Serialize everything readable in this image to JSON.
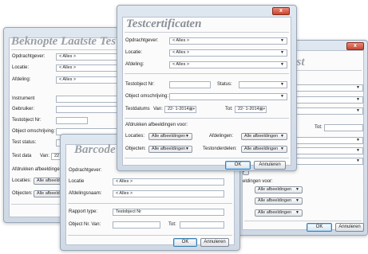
{
  "back_left": {
    "title": "Beknopte Laatste Tes",
    "opdrachtgever_label": "Opdrachtgever:",
    "opdrachtgever_value": "< Alles >",
    "locatie_label": "Locatie:",
    "locatie_value": "< Alles >",
    "afdeling_label": "Afdeling:",
    "afdeling_value": "< Alles >",
    "instrument_label": "Instrument",
    "gebruiker_label": "Gebruiker:",
    "testobject_label": "Testobject Nr:",
    "omschrijving_label": "Object omschrijving:",
    "teststatus_label": "Test status:",
    "testdata_label": "Test data",
    "van_label": "Van:",
    "van_value": "22",
    "afdrukken_label": "Afdrukken afbeeldingen",
    "locaties_label": "Locaties:",
    "locaties_value": "Alle afbeeldi",
    "objecten_label": "Objecten:",
    "objecten_value": "Alle afbeeldi"
  },
  "back_right": {
    "title": "enlijst",
    "tot_label": "Tot:",
    "afdrukken_label": "eldingen voor:",
    "opt1": "Alle afbeeldingen",
    "opt2": "Alle afbeeldingen",
    "opt3": "Alle afbeeldingen",
    "ok_label": "OK",
    "cancel_label": "Annuleren"
  },
  "barcode": {
    "title": "Barcode li",
    "opdrachtgever_label": "Opdrachtgever:",
    "locatie_label": "Locatie",
    "locatie_value": "< Alles >",
    "afdelingsnaam_label": "Afdelingsnaam:",
    "afdelingsnaam_value": "< Alles >",
    "rapport_label": "Rapport type:",
    "rapport_value": "Testobject Nr",
    "objectnr_label": "Object Nr. Van:",
    "tot_label": "Tot:",
    "ok_label": "OK",
    "cancel_label": "Annuleren"
  },
  "front": {
    "title": "Testcertificaten",
    "close_glyph": "x",
    "opdrachtgever_label": "Opdrachtgever:",
    "opdrachtgever_value": "< Alles >",
    "locatie_label": "Locatie:",
    "locatie_value": "< Alles >",
    "afdeling_label": "Afdeling:",
    "afdeling_value": "< Alles >",
    "testobject_label": "Testobject Nr:",
    "status_label": "Status:",
    "omschrijving_label": "Object omschrijving:",
    "testdatums_label": "Testdatums",
    "van_label": "Van:",
    "van_value": "22- 1-2014",
    "tot_label": "Tot:",
    "tot_value": "22- 1-2014",
    "afdrukken_label": "Afdrukken afbeeldingen voor:",
    "locaties_label": "Locaties:",
    "locaties_value": "Alle afbeeldingen",
    "afdelingen_label": "Afdelingen:",
    "afdelingen_value": "Alle afbeeldingen",
    "objecten_label": "Objecten:",
    "objecten_value": "Alle afbeeldingen",
    "testonderdelen_label": "Testonderdelen:",
    "testonderdelen_value": "Alle afbeeldingen",
    "ok_label": "OK",
    "cancel_label": "Annuleren"
  }
}
